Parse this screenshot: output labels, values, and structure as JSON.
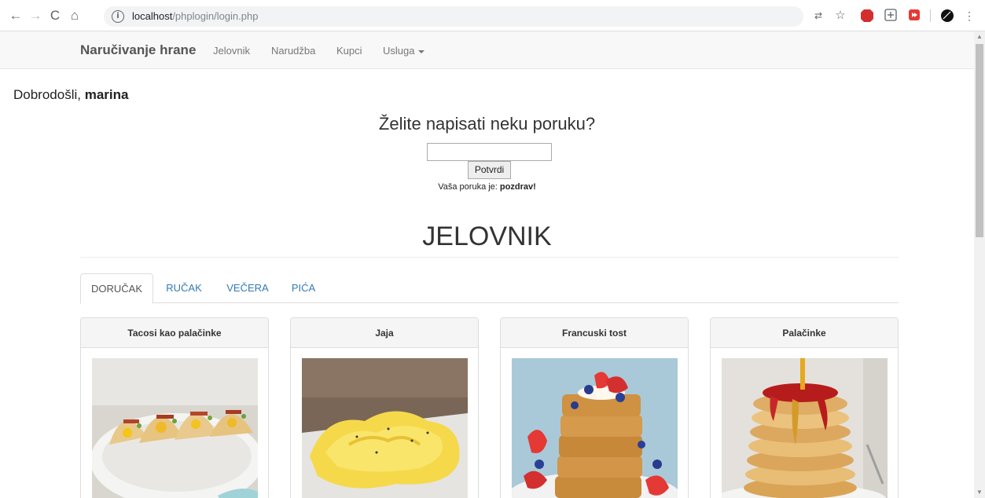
{
  "browser": {
    "url_host": "localhost",
    "url_path": "/phplogin/login.php"
  },
  "navbar": {
    "brand": "Naručivanje hrane",
    "links": [
      "Jelovnik",
      "Narudžba",
      "Kupci",
      "Usluga"
    ]
  },
  "welcome": {
    "prefix": "Dobrodošli, ",
    "user": "marina"
  },
  "message_form": {
    "question": "Želite napisati neku poruku?",
    "input_value": "",
    "submit_label": "Potvrdi",
    "result_prefix": "Vaša poruka je: ",
    "result_value": "pozdrav!"
  },
  "menu": {
    "title": "JELOVNIK",
    "tabs": [
      "DORUČAK",
      "RUČAK",
      "VEČERA",
      "PIĆA"
    ],
    "active_tab": "DORUČAK",
    "items": [
      {
        "name": "Tacosi kao palačinke"
      },
      {
        "name": "Jaja"
      },
      {
        "name": "Francuski tost"
      },
      {
        "name": "Palačinke"
      }
    ]
  },
  "colors": {
    "link": "#337ab7",
    "navbar_bg": "#f8f8f8"
  }
}
